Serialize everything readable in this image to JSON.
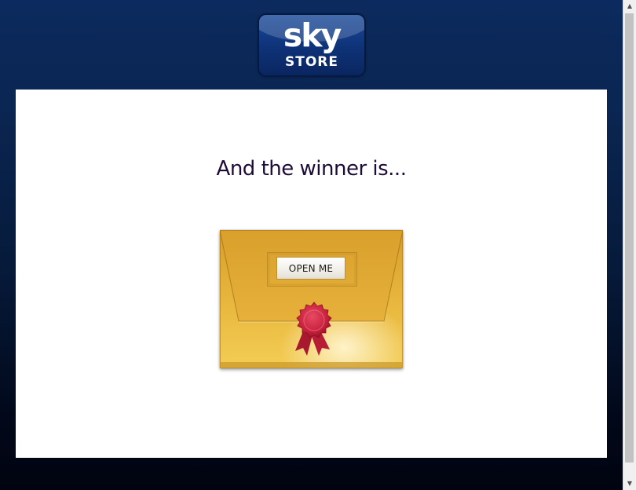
{
  "logo": {
    "top_text": "sky",
    "bottom_text": "STORE"
  },
  "main": {
    "headline": "And the winner is...",
    "envelope": {
      "button_label": "OPEN ME",
      "seal_icon": "wax-seal-ribbon-icon"
    }
  },
  "scrollbar": {
    "up_icon": "▲",
    "down_icon": "▼"
  },
  "colors": {
    "background_top": "#0c2a5e",
    "background_bottom": "#010410",
    "panel": "#ffffff",
    "headline_text": "#1e0c38",
    "envelope_gold": "#e8b93e",
    "seal_red": "#c8213e"
  }
}
